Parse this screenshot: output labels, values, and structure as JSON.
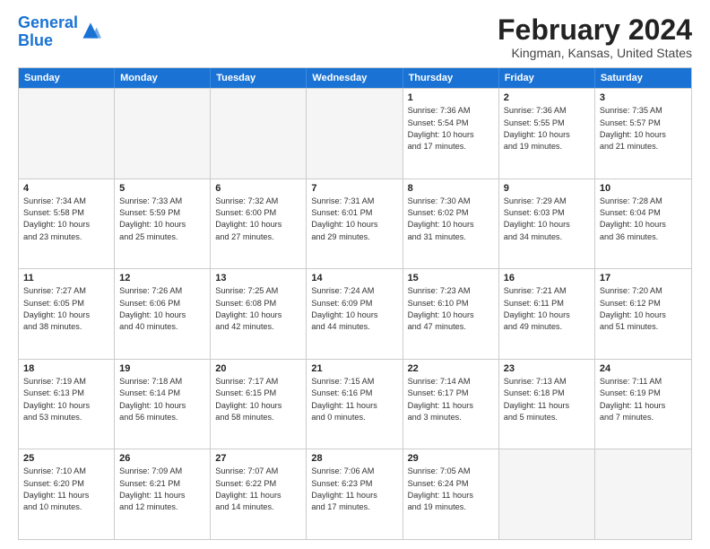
{
  "header": {
    "logo_line1": "General",
    "logo_line2": "Blue",
    "title": "February 2024",
    "subtitle": "Kingman, Kansas, United States"
  },
  "days_of_week": [
    "Sunday",
    "Monday",
    "Tuesday",
    "Wednesday",
    "Thursday",
    "Friday",
    "Saturday"
  ],
  "weeks": [
    [
      {
        "day": "",
        "lines": []
      },
      {
        "day": "",
        "lines": []
      },
      {
        "day": "",
        "lines": []
      },
      {
        "day": "",
        "lines": []
      },
      {
        "day": "1",
        "lines": [
          "Sunrise: 7:36 AM",
          "Sunset: 5:54 PM",
          "Daylight: 10 hours",
          "and 17 minutes."
        ]
      },
      {
        "day": "2",
        "lines": [
          "Sunrise: 7:36 AM",
          "Sunset: 5:55 PM",
          "Daylight: 10 hours",
          "and 19 minutes."
        ]
      },
      {
        "day": "3",
        "lines": [
          "Sunrise: 7:35 AM",
          "Sunset: 5:57 PM",
          "Daylight: 10 hours",
          "and 21 minutes."
        ]
      }
    ],
    [
      {
        "day": "4",
        "lines": [
          "Sunrise: 7:34 AM",
          "Sunset: 5:58 PM",
          "Daylight: 10 hours",
          "and 23 minutes."
        ]
      },
      {
        "day": "5",
        "lines": [
          "Sunrise: 7:33 AM",
          "Sunset: 5:59 PM",
          "Daylight: 10 hours",
          "and 25 minutes."
        ]
      },
      {
        "day": "6",
        "lines": [
          "Sunrise: 7:32 AM",
          "Sunset: 6:00 PM",
          "Daylight: 10 hours",
          "and 27 minutes."
        ]
      },
      {
        "day": "7",
        "lines": [
          "Sunrise: 7:31 AM",
          "Sunset: 6:01 PM",
          "Daylight: 10 hours",
          "and 29 minutes."
        ]
      },
      {
        "day": "8",
        "lines": [
          "Sunrise: 7:30 AM",
          "Sunset: 6:02 PM",
          "Daylight: 10 hours",
          "and 31 minutes."
        ]
      },
      {
        "day": "9",
        "lines": [
          "Sunrise: 7:29 AM",
          "Sunset: 6:03 PM",
          "Daylight: 10 hours",
          "and 34 minutes."
        ]
      },
      {
        "day": "10",
        "lines": [
          "Sunrise: 7:28 AM",
          "Sunset: 6:04 PM",
          "Daylight: 10 hours",
          "and 36 minutes."
        ]
      }
    ],
    [
      {
        "day": "11",
        "lines": [
          "Sunrise: 7:27 AM",
          "Sunset: 6:05 PM",
          "Daylight: 10 hours",
          "and 38 minutes."
        ]
      },
      {
        "day": "12",
        "lines": [
          "Sunrise: 7:26 AM",
          "Sunset: 6:06 PM",
          "Daylight: 10 hours",
          "and 40 minutes."
        ]
      },
      {
        "day": "13",
        "lines": [
          "Sunrise: 7:25 AM",
          "Sunset: 6:08 PM",
          "Daylight: 10 hours",
          "and 42 minutes."
        ]
      },
      {
        "day": "14",
        "lines": [
          "Sunrise: 7:24 AM",
          "Sunset: 6:09 PM",
          "Daylight: 10 hours",
          "and 44 minutes."
        ]
      },
      {
        "day": "15",
        "lines": [
          "Sunrise: 7:23 AM",
          "Sunset: 6:10 PM",
          "Daylight: 10 hours",
          "and 47 minutes."
        ]
      },
      {
        "day": "16",
        "lines": [
          "Sunrise: 7:21 AM",
          "Sunset: 6:11 PM",
          "Daylight: 10 hours",
          "and 49 minutes."
        ]
      },
      {
        "day": "17",
        "lines": [
          "Sunrise: 7:20 AM",
          "Sunset: 6:12 PM",
          "Daylight: 10 hours",
          "and 51 minutes."
        ]
      }
    ],
    [
      {
        "day": "18",
        "lines": [
          "Sunrise: 7:19 AM",
          "Sunset: 6:13 PM",
          "Daylight: 10 hours",
          "and 53 minutes."
        ]
      },
      {
        "day": "19",
        "lines": [
          "Sunrise: 7:18 AM",
          "Sunset: 6:14 PM",
          "Daylight: 10 hours",
          "and 56 minutes."
        ]
      },
      {
        "day": "20",
        "lines": [
          "Sunrise: 7:17 AM",
          "Sunset: 6:15 PM",
          "Daylight: 10 hours",
          "and 58 minutes."
        ]
      },
      {
        "day": "21",
        "lines": [
          "Sunrise: 7:15 AM",
          "Sunset: 6:16 PM",
          "Daylight: 11 hours",
          "and 0 minutes."
        ]
      },
      {
        "day": "22",
        "lines": [
          "Sunrise: 7:14 AM",
          "Sunset: 6:17 PM",
          "Daylight: 11 hours",
          "and 3 minutes."
        ]
      },
      {
        "day": "23",
        "lines": [
          "Sunrise: 7:13 AM",
          "Sunset: 6:18 PM",
          "Daylight: 11 hours",
          "and 5 minutes."
        ]
      },
      {
        "day": "24",
        "lines": [
          "Sunrise: 7:11 AM",
          "Sunset: 6:19 PM",
          "Daylight: 11 hours",
          "and 7 minutes."
        ]
      }
    ],
    [
      {
        "day": "25",
        "lines": [
          "Sunrise: 7:10 AM",
          "Sunset: 6:20 PM",
          "Daylight: 11 hours",
          "and 10 minutes."
        ]
      },
      {
        "day": "26",
        "lines": [
          "Sunrise: 7:09 AM",
          "Sunset: 6:21 PM",
          "Daylight: 11 hours",
          "and 12 minutes."
        ]
      },
      {
        "day": "27",
        "lines": [
          "Sunrise: 7:07 AM",
          "Sunset: 6:22 PM",
          "Daylight: 11 hours",
          "and 14 minutes."
        ]
      },
      {
        "day": "28",
        "lines": [
          "Sunrise: 7:06 AM",
          "Sunset: 6:23 PM",
          "Daylight: 11 hours",
          "and 17 minutes."
        ]
      },
      {
        "day": "29",
        "lines": [
          "Sunrise: 7:05 AM",
          "Sunset: 6:24 PM",
          "Daylight: 11 hours",
          "and 19 minutes."
        ]
      },
      {
        "day": "",
        "lines": []
      },
      {
        "day": "",
        "lines": []
      }
    ]
  ]
}
